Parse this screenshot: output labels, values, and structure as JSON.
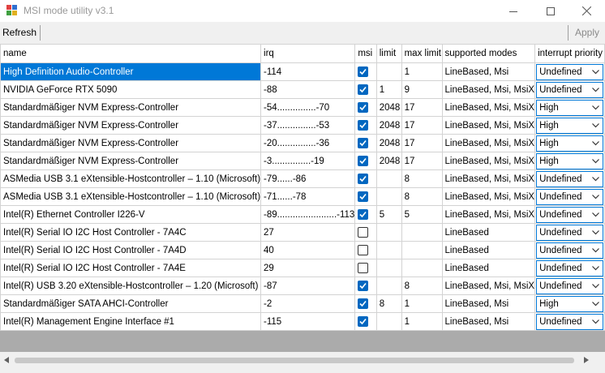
{
  "window": {
    "title": "MSI mode utility v3.1"
  },
  "toolbar": {
    "refresh_label": "Refresh",
    "apply_label": "Apply"
  },
  "columns": [
    "name",
    "irq",
    "msi",
    "limit",
    "max limit",
    "supported modes",
    "interrupt priority"
  ],
  "rows": [
    {
      "name": "High Definition Audio-Controller",
      "irq": "-114",
      "msi": true,
      "limit": "",
      "max_limit": "1",
      "modes": "LineBased, Msi",
      "priority": "Undefined"
    },
    {
      "name": "NVIDIA GeForce RTX 5090",
      "irq": "-88",
      "msi": true,
      "limit": "1",
      "max_limit": "9",
      "modes": "LineBased, Msi, MsiX",
      "priority": "Undefined"
    },
    {
      "name": "Standardmäßiger NVM Express-Controller",
      "irq": "-54...............-70",
      "msi": true,
      "limit": "2048",
      "max_limit": "17",
      "modes": "LineBased, Msi, MsiX",
      "priority": "High"
    },
    {
      "name": "Standardmäßiger NVM Express-Controller",
      "irq": "-37...............-53",
      "msi": true,
      "limit": "2048",
      "max_limit": "17",
      "modes": "LineBased, Msi, MsiX",
      "priority": "High"
    },
    {
      "name": "Standardmäßiger NVM Express-Controller",
      "irq": "-20...............-36",
      "msi": true,
      "limit": "2048",
      "max_limit": "17",
      "modes": "LineBased, Msi, MsiX",
      "priority": "High"
    },
    {
      "name": "Standardmäßiger NVM Express-Controller",
      "irq": "-3...............-19",
      "msi": true,
      "limit": "2048",
      "max_limit": "17",
      "modes": "LineBased, Msi, MsiX",
      "priority": "High"
    },
    {
      "name": "ASMedia USB 3.1 eXtensible-Hostcontroller – 1.10 (Microsoft)",
      "irq": "-79......-86",
      "msi": true,
      "limit": "",
      "max_limit": "8",
      "modes": "LineBased, Msi, MsiX",
      "priority": "Undefined"
    },
    {
      "name": "ASMedia USB 3.1 eXtensible-Hostcontroller – 1.10 (Microsoft)",
      "irq": "-71......-78",
      "msi": true,
      "limit": "",
      "max_limit": "8",
      "modes": "LineBased, Msi, MsiX",
      "priority": "Undefined"
    },
    {
      "name": "Intel(R) Ethernet Controller I226-V",
      "irq": "-89.......................-113",
      "msi": true,
      "limit": "5",
      "max_limit": "5",
      "modes": "LineBased, Msi, MsiX",
      "priority": "Undefined"
    },
    {
      "name": "Intel(R) Serial IO I2C Host Controller - 7A4C",
      "irq": "27",
      "msi": false,
      "limit": "",
      "max_limit": "",
      "modes": "LineBased",
      "priority": "Undefined"
    },
    {
      "name": "Intel(R) Serial IO I2C Host Controller - 7A4D",
      "irq": "40",
      "msi": false,
      "limit": "",
      "max_limit": "",
      "modes": "LineBased",
      "priority": "Undefined"
    },
    {
      "name": "Intel(R) Serial IO I2C Host Controller - 7A4E",
      "irq": "29",
      "msi": false,
      "limit": "",
      "max_limit": "",
      "modes": "LineBased",
      "priority": "Undefined"
    },
    {
      "name": "Intel(R) USB 3.20 eXtensible-Hostcontroller – 1.20 (Microsoft)",
      "irq": "-87",
      "msi": true,
      "limit": "",
      "max_limit": "8",
      "modes": "LineBased, Msi, MsiX",
      "priority": "Undefined"
    },
    {
      "name": "Standardmäßiger SATA AHCI-Controller",
      "irq": "-2",
      "msi": true,
      "limit": "8",
      "max_limit": "1",
      "modes": "LineBased, Msi",
      "priority": "High"
    },
    {
      "name": "Intel(R) Management Engine Interface #1",
      "irq": "-115",
      "msi": true,
      "limit": "",
      "max_limit": "1",
      "modes": "LineBased, Msi",
      "priority": "Undefined"
    }
  ],
  "colors": {
    "selection": "#0078d7",
    "checkbox_checked": "#0067c0",
    "grid_background": "#ababab"
  },
  "icons": [
    "app-icon",
    "minimize-icon",
    "maximize-icon",
    "close-icon",
    "checkbox-checked-icon",
    "chevron-down-icon",
    "scroll-left-icon",
    "scroll-right-icon"
  ]
}
